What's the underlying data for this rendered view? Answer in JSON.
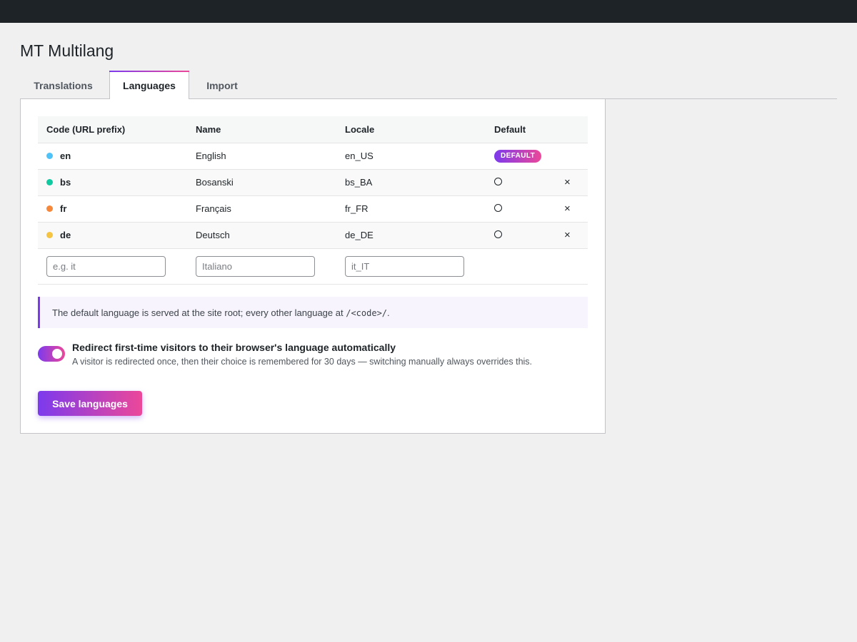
{
  "page": {
    "title": "MT Multilang"
  },
  "tabs": [
    {
      "label": "Translations"
    },
    {
      "label": "Languages"
    },
    {
      "label": "Import"
    }
  ],
  "table": {
    "headers": [
      "Code (URL prefix)",
      "Name",
      "Locale",
      "Default"
    ],
    "rows": [
      {
        "code": "en",
        "name": "English",
        "locale": "en_US",
        "dot_color": "#4fc3f7",
        "is_default": true,
        "badge": "DEFAULT"
      },
      {
        "code": "bs",
        "name": "Bosanski",
        "locale": "bs_BA",
        "dot_color": "#10c9a0",
        "is_default": false,
        "remove": "×"
      },
      {
        "code": "fr",
        "name": "Français",
        "locale": "fr_FR",
        "dot_color": "#f5883a",
        "is_default": false,
        "remove": "×"
      },
      {
        "code": "de",
        "name": "Deutsch",
        "locale": "de_DE",
        "dot_color": "#f5c443",
        "is_default": false,
        "remove": "×"
      }
    ],
    "new_row": {
      "code_placeholder": "e.g. it",
      "name_placeholder": "Italiano",
      "locale_placeholder": "it_IT"
    }
  },
  "notice": {
    "text_before": "The default language is served at the site root; every other language at ",
    "code": "/<code>/",
    "text_after": "."
  },
  "redirect": {
    "enabled": true,
    "title": "Redirect first-time visitors to their browser's language automatically",
    "description": "A visitor is redirected once, then their choice is remembered for 30 days — switching manually always overrides this."
  },
  "save_label": "Save languages",
  "colors": {
    "accent_start": "#7c3aed",
    "accent_end": "#ec4899",
    "admin_bar": "#1d2327"
  }
}
